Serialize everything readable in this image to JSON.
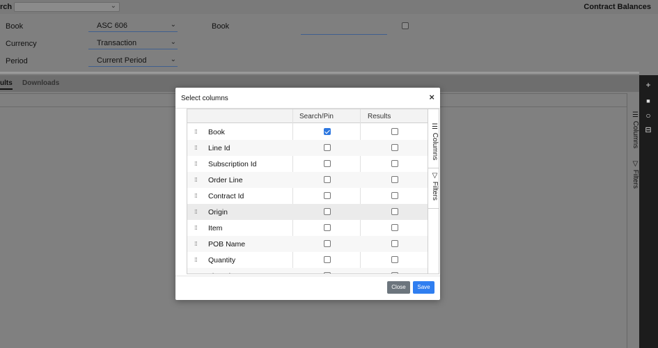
{
  "header": {
    "truncated_label": "rch",
    "app_title": "Contract Balances"
  },
  "filters": {
    "book_label": "Book",
    "book_value": "ASC 606",
    "currency_label": "Currency",
    "currency_value": "Transaction",
    "period_label": "Period",
    "period_value": "Current Period",
    "book_label_2": "Book"
  },
  "tabs": {
    "results": "ults",
    "downloads": "Downloads"
  },
  "side_panel": {
    "columns": "Columns",
    "filters": "Filters"
  },
  "toolbar": {
    "add_icon": "plus-icon",
    "save_icon": "save-icon",
    "refresh_icon": "circle-icon",
    "layout_icon": "table-icon"
  },
  "modal": {
    "title": "Select columns",
    "close_glyph": "×",
    "col_search_pin": "Search/Pin",
    "col_results": "Results",
    "rows": [
      {
        "name": "Book",
        "search_pin": true,
        "results": false
      },
      {
        "name": "Line Id",
        "search_pin": false,
        "results": false
      },
      {
        "name": "Subscription Id",
        "search_pin": false,
        "results": false
      },
      {
        "name": "Order Line",
        "search_pin": false,
        "results": false
      },
      {
        "name": "Contract Id",
        "search_pin": false,
        "results": false
      },
      {
        "name": "Origin",
        "search_pin": false,
        "results": false
      },
      {
        "name": "Item",
        "search_pin": false,
        "results": false
      },
      {
        "name": "POB Name",
        "search_pin": false,
        "results": false
      },
      {
        "name": "Quantity",
        "search_pin": false,
        "results": false
      },
      {
        "name": "List Price",
        "search_pin": false,
        "results": false
      }
    ],
    "sidebar_columns": "Columns",
    "sidebar_filters": "Filters",
    "close_button": "Close",
    "save_button": "Save"
  },
  "colors": {
    "accent": "#2f7ef0",
    "secondary": "#6c757d"
  }
}
